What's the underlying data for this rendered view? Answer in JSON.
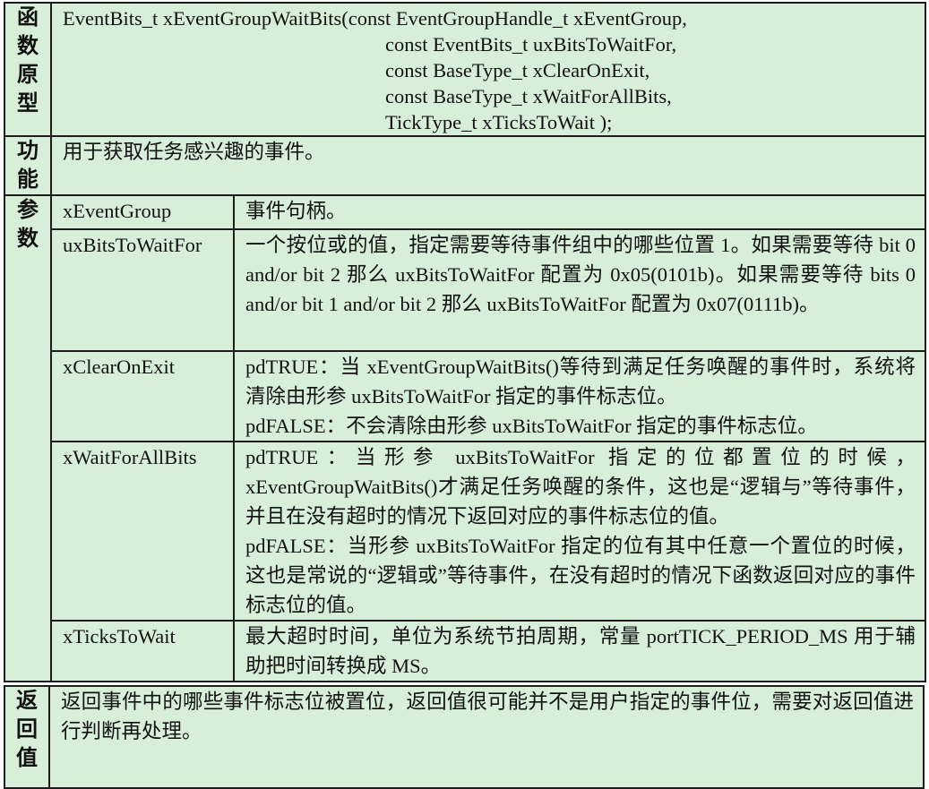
{
  "prototype": {
    "header": [
      "函",
      "数",
      "原",
      "型"
    ],
    "lines": [
      "EventBits_t xEventGroupWaitBits(const EventGroupHandle_t xEventGroup,",
      "const EventBits_t uxBitsToWaitFor,",
      "const BaseType_t xClearOnExit,",
      "const BaseType_t xWaitForAllBits,",
      "TickType_t xTicksToWait );"
    ]
  },
  "function": {
    "header": [
      "功",
      "能"
    ],
    "text": "用于获取任务感兴趣的事件。"
  },
  "params": {
    "header": [
      "参",
      "数"
    ],
    "rows": [
      {
        "name": "xEventGroup",
        "desc": [
          "事件句柄。"
        ]
      },
      {
        "name": "uxBitsToWaitFor",
        "desc": [
          "一个按位或的值，指定需要等待事件组中的哪些位置 1。如果需要等待 bit 0 and/or bit 2 那么 uxBitsToWaitFor 配置为 0x05(0101b)。如果需要等待 bits 0 and/or bit 1 and/or bit 2 那么 uxBitsToWaitFor 配置为 0x07(0111b)。"
        ]
      },
      {
        "name": "xClearOnExit",
        "desc": [
          "pdTRUE：当 xEventGroupWaitBits()等待到满足任务唤醒的事件时，系统将清除由形参 uxBitsToWaitFor 指定的事件标志位。",
          "pdFALSE：不会清除由形参 uxBitsToWaitFor 指定的事件标志位。"
        ]
      },
      {
        "name": "xWaitForAllBits",
        "desc": [
          "pdTRUE：当形参 uxBitsToWaitFor 指定的位都置位的时候，xEventGroupWaitBits()才满足任务唤醒的条件，这也是“逻辑与”等待事件，并且在没有超时的情况下返回对应的事件标志位的值。",
          "pdFALSE：当形参 uxBitsToWaitFor 指定的位有其中任意一个置位的时候，这也是常说的“逻辑或”等待事件，在没有超时的情况下函数返回对应的事件标志位的值。"
        ]
      },
      {
        "name": "xTicksToWait",
        "desc": [
          "最大超时时间，单位为系统节拍周期，常量 portTICK_PERIOD_MS 用于辅助把时间转换成 MS。"
        ]
      }
    ]
  },
  "return": {
    "header": [
      "返",
      "回",
      "值"
    ],
    "text": "返回事件中的哪些事件标志位被置位，返回值很可能并不是用户指定的事件位，需要对返回值进行判断再处理。"
  },
  "colors": {
    "background": "#d7efd9",
    "border": "#1d1d1d"
  }
}
